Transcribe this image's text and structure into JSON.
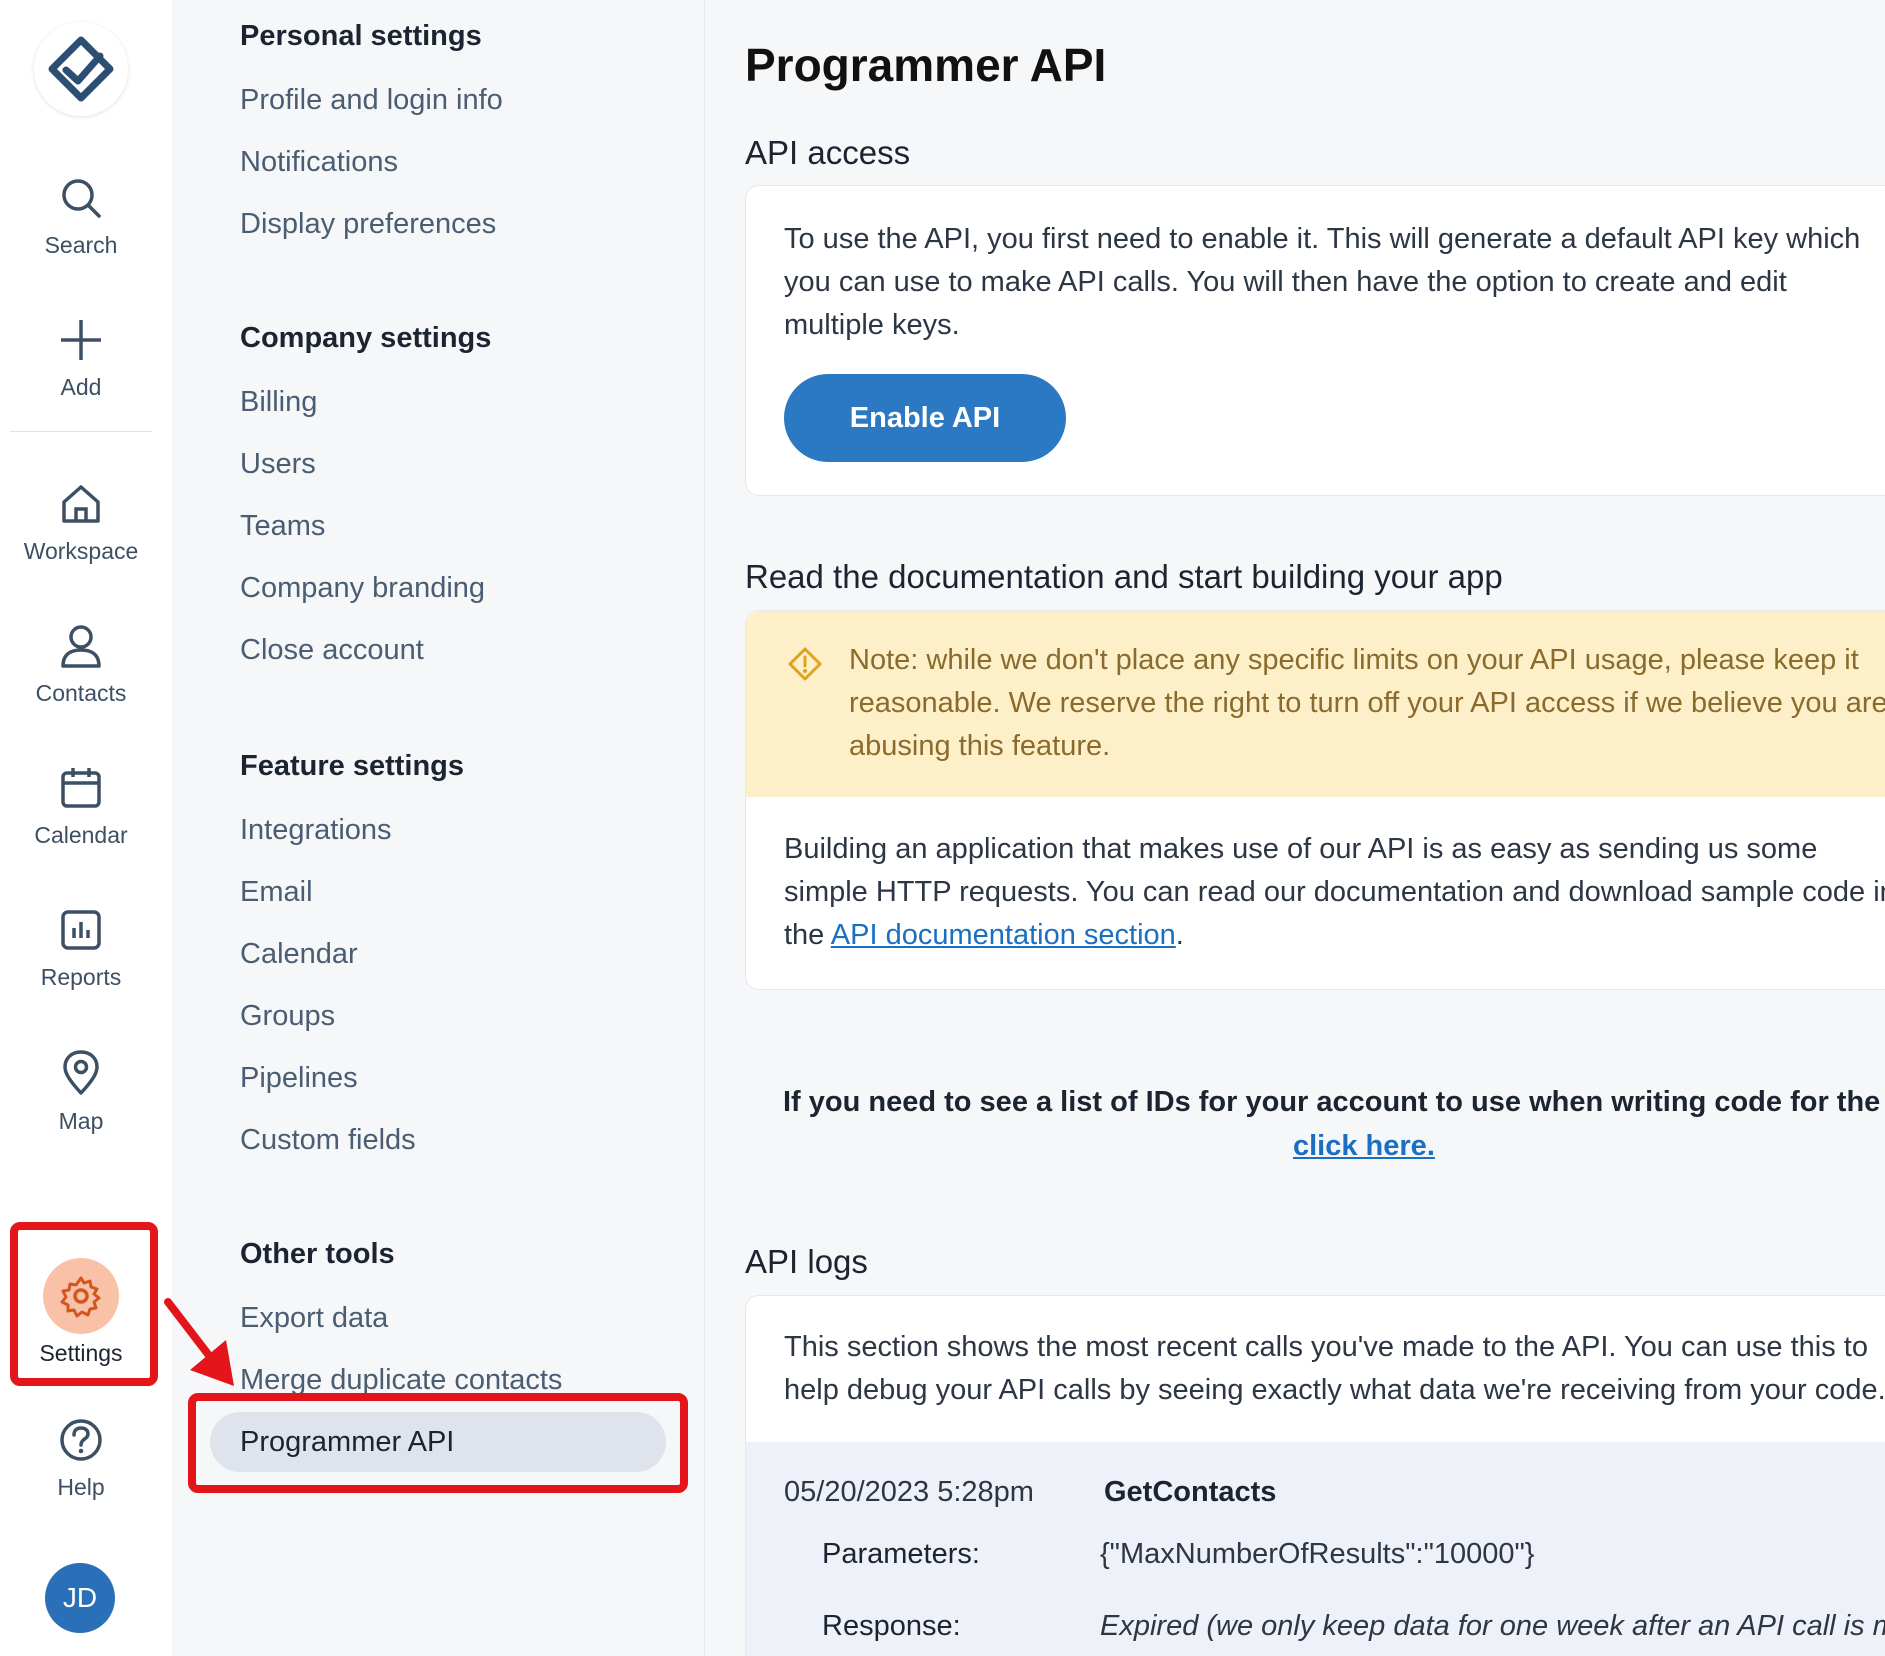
{
  "rail": {
    "items": [
      {
        "label": "Search",
        "icon": "search-icon"
      },
      {
        "label": "Add",
        "icon": "plus-icon"
      },
      {
        "label": "Workspace",
        "icon": "home-icon"
      },
      {
        "label": "Contacts",
        "icon": "person-icon"
      },
      {
        "label": "Calendar",
        "icon": "calendar-icon"
      },
      {
        "label": "Reports",
        "icon": "chart-icon"
      },
      {
        "label": "Map",
        "icon": "map-pin-icon"
      },
      {
        "label": "Settings",
        "icon": "gear-icon"
      },
      {
        "label": "Help",
        "icon": "help-icon"
      }
    ],
    "avatar": "JD"
  },
  "nav": {
    "personal": {
      "title": "Personal settings",
      "links": [
        "Profile and login info",
        "Notifications",
        "Display preferences"
      ]
    },
    "company": {
      "title": "Company settings",
      "links": [
        "Billing",
        "Users",
        "Teams",
        "Company branding",
        "Close account"
      ]
    },
    "feature": {
      "title": "Feature settings",
      "links": [
        "Integrations",
        "Email",
        "Calendar",
        "Groups",
        "Pipelines",
        "Custom fields"
      ]
    },
    "other": {
      "title": "Other tools",
      "links": [
        "Export data",
        "Merge duplicate contacts"
      ],
      "active": "Programmer API"
    }
  },
  "main": {
    "title": "Programmer API",
    "api_access": {
      "heading": "API access",
      "text": "To use the API, you first need to enable it. This will generate a default API key which you can use to make API calls. You will then have the option to create and edit multiple keys.",
      "button": "Enable API"
    },
    "docs": {
      "heading": "Read the documentation and start building your app",
      "note": "Note: while we don't place any specific limits on your API usage, please keep it reasonable. We reserve the right to turn off your API access if we believe you are abusing this feature.",
      "body_before": "Building an application that makes use of our API is as easy as sending us some simple HTTP requests. You can read our documentation and download sample code in the ",
      "link": "API documentation section",
      "body_after": "."
    },
    "ids": {
      "text": "If you need to see a list of IDs for your account to use when writing code for the API,",
      "link": "click here."
    },
    "logs": {
      "heading": "API logs",
      "text": "This section shows the most recent calls you've made to the API. You can use this to help debug your API calls by seeing exactly what data we're receiving from your code.",
      "entry": {
        "time": "05/20/2023 5:28pm",
        "method": "GetContacts",
        "params_label": "Parameters:",
        "params_value": "{\"MaxNumberOfResults\":\"10000\"}",
        "response_label": "Response:",
        "response_value": "Expired (we only keep data for one week after an API call is made)"
      }
    }
  },
  "colors": {
    "accent": "#2b79c2",
    "highlight": "#e3151b",
    "note_bg": "#fdf0c9"
  }
}
